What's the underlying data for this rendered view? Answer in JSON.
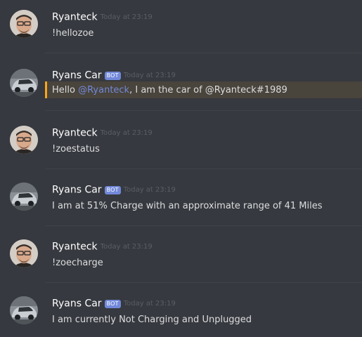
{
  "messages": [
    {
      "author": "Ryanteck",
      "is_bot": false,
      "timestamp": "Today at 23:19",
      "content": "!hellozoe"
    },
    {
      "author": "Ryans Car",
      "is_bot": true,
      "bot_tag": "BOT",
      "timestamp": "Today at 23:19",
      "content_prefix": "Hello ",
      "mention": "@Ryanteck",
      "content_suffix": ", I am the car of @Ryanteck#1989",
      "highlighted": true
    },
    {
      "author": "Ryanteck",
      "is_bot": false,
      "timestamp": "Today at 23:19",
      "content": "!zoestatus"
    },
    {
      "author": "Ryans Car",
      "is_bot": true,
      "bot_tag": "BOT",
      "timestamp": "Today at 23:19",
      "content": "I am at 51% Charge with an approximate range of 41 Miles"
    },
    {
      "author": "Ryanteck",
      "is_bot": false,
      "timestamp": "Today at 23:19",
      "content": "!zoecharge"
    },
    {
      "author": "Ryans Car",
      "is_bot": true,
      "bot_tag": "BOT",
      "timestamp": "Today at 23:19",
      "content": "I am currently Not Charging and Unplugged"
    }
  ],
  "colors": {
    "background": "#36393f",
    "mention": "#7289da",
    "bot_tag": "#7289da",
    "highlight_bar": "#faa61a",
    "highlight_bg": "#49443c"
  },
  "icons": {
    "user_avatar": "user-avatar-icon",
    "car_avatar": "car-avatar-icon"
  }
}
